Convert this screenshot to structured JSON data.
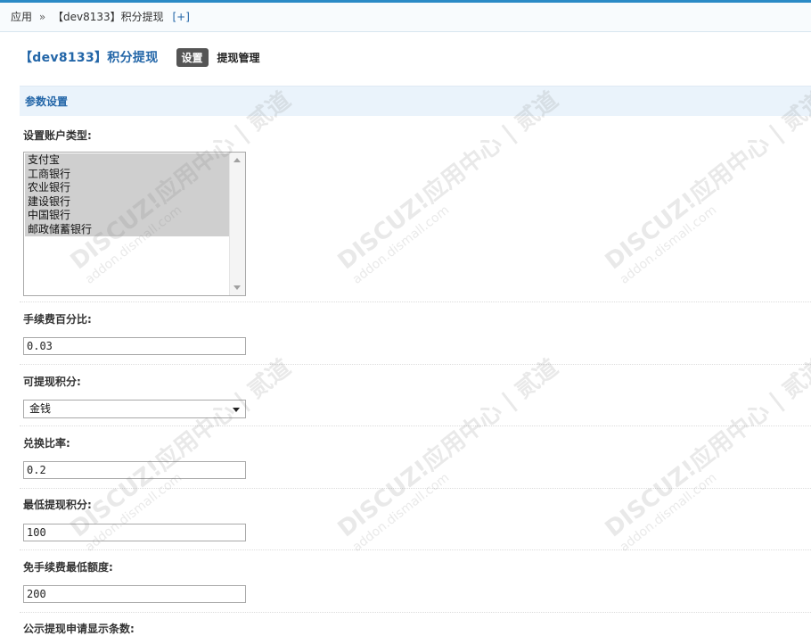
{
  "breadcrumb": {
    "root": "应用",
    "sep": "»",
    "current": "【dev8133】积分提现",
    "add": "[+]"
  },
  "header": {
    "title": "【dev8133】积分提现",
    "tab_settings": "设置",
    "tab_manage": "提现管理"
  },
  "section_title": "参数设置",
  "fields": {
    "account_types": {
      "label": "设置账户类型:",
      "options": [
        "支付宝",
        "工商银行",
        "农业银行",
        "建设银行",
        "中国银行",
        "邮政储蓄银行"
      ]
    },
    "fee_percent": {
      "label": "手续费百分比:",
      "value": "0.03"
    },
    "credit_type": {
      "label": "可提现积分:",
      "selected": "金钱"
    },
    "exchange_rate": {
      "label": "兑换比率:",
      "value": "0.2"
    },
    "min_withdraw": {
      "label": "最低提现积分:",
      "value": "100"
    },
    "fee_free_min": {
      "label": "免手续费最低额度:",
      "value": "200"
    },
    "public_count": {
      "label": "公示提现申请显示条数:"
    }
  },
  "watermark": {
    "brand": "DISCUZ!应用中心 | 贰道",
    "domain": "addon.dismall.com"
  },
  "colors": {
    "accent": "#2b8ac6",
    "title_blue": "#2366a8",
    "section_bg": "#eaf3fb",
    "tab_active_bg": "#555555"
  }
}
